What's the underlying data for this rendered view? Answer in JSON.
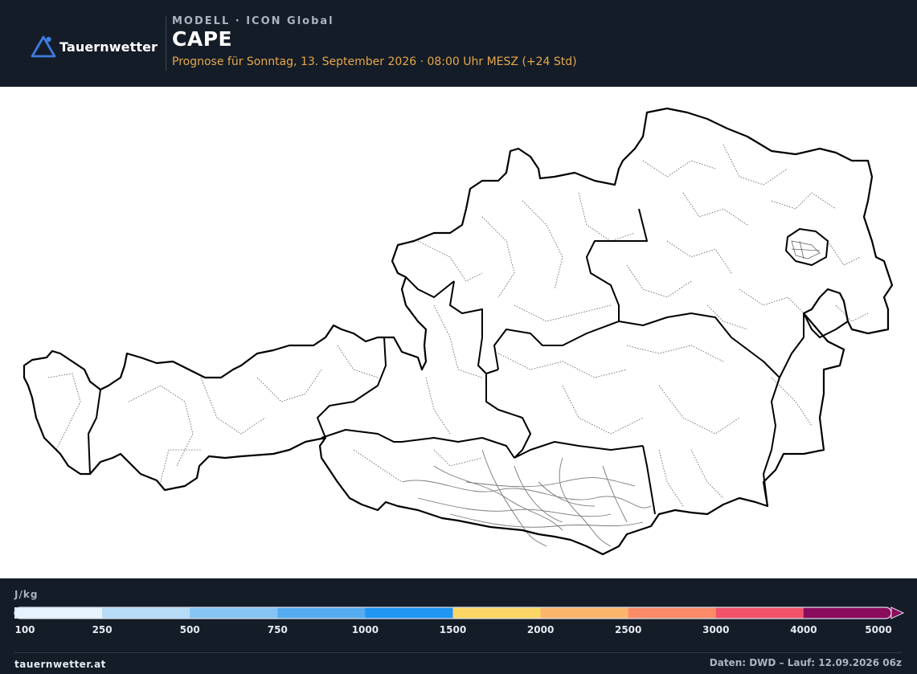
{
  "header": {
    "brand": "Tauernwetter",
    "model_label": "MODELL · ICON Global",
    "title": "CAPE",
    "subtitle": "Prognose für Sonntag, 13. September 2026 · 08:00 Uhr MESZ  (+24 Std)",
    "logo_icon": "mountain-triangle-icon",
    "accent_color": "#3d7be0",
    "subtitle_color": "#e6a84a"
  },
  "map": {
    "region": "Austria",
    "border_color": "#000000",
    "field_values_shown": false
  },
  "legend": {
    "unit": "J/kg",
    "ticks": [
      "100",
      "250",
      "500",
      "750",
      "1000",
      "1500",
      "2000",
      "2500",
      "3000",
      "4000",
      "5000"
    ],
    "bins": [
      {
        "from": 100,
        "to": 250,
        "color": "#e8f4fd"
      },
      {
        "from": 250,
        "to": 500,
        "color": "#b6dcf8"
      },
      {
        "from": 500,
        "to": 750,
        "color": "#86c4f4"
      },
      {
        "from": 750,
        "to": 1000,
        "color": "#55acf0"
      },
      {
        "from": 1000,
        "to": 1500,
        "color": "#2196f3"
      },
      {
        "from": 1500,
        "to": 2000,
        "color": "#fdd766"
      },
      {
        "from": 2000,
        "to": 2500,
        "color": "#fdb56b"
      },
      {
        "from": 2500,
        "to": 3000,
        "color": "#fb8a66"
      },
      {
        "from": 3000,
        "to": 4000,
        "color": "#f1526a"
      },
      {
        "from": 4000,
        "to": 5000,
        "color": "#8b0b5d"
      }
    ],
    "overflow_arrow": true
  },
  "footer": {
    "site": "tauernwetter.at",
    "source": "Daten: DWD – Lauf: 12.09.2026 06z"
  }
}
